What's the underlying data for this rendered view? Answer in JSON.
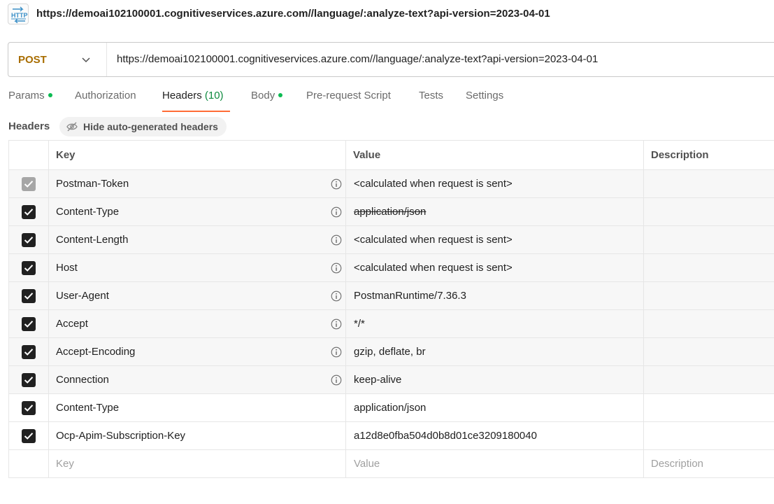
{
  "titlebar": {
    "icon": "http-icon",
    "url": "https://demoai102100001.cognitiveservices.azure.com//language/:analyze-text?api-version=2023-04-01"
  },
  "request": {
    "method": "POST",
    "url": "https://demoai102100001.cognitiveservices.azure.com//language/:analyze-text?api-version=2023-04-01"
  },
  "tabs": [
    {
      "label": "Params",
      "dot": true
    },
    {
      "label": "Authorization",
      "dot": false
    },
    {
      "label": "Headers",
      "count": "(10)",
      "active": true
    },
    {
      "label": "Body",
      "dot": true
    },
    {
      "label": "Pre-request Script",
      "dot": false
    },
    {
      "label": "Tests",
      "dot": false
    },
    {
      "label": "Settings",
      "dot": false
    }
  ],
  "headers_section": {
    "label": "Headers",
    "hide_button": "Hide auto-generated headers"
  },
  "table": {
    "columns": {
      "key": "Key",
      "value": "Value",
      "description": "Description"
    },
    "rows": [
      {
        "key": "Postman-Token",
        "value": "<calculated when request is sent>",
        "checked": true,
        "disabled": true,
        "auto": true,
        "struck": false
      },
      {
        "key": "Content-Type",
        "value": "application/json",
        "checked": true,
        "disabled": false,
        "auto": true,
        "struck": true
      },
      {
        "key": "Content-Length",
        "value": "<calculated when request is sent>",
        "checked": true,
        "disabled": false,
        "auto": true,
        "struck": false
      },
      {
        "key": "Host",
        "value": "<calculated when request is sent>",
        "checked": true,
        "disabled": false,
        "auto": true,
        "struck": false
      },
      {
        "key": "User-Agent",
        "value": "PostmanRuntime/7.36.3",
        "checked": true,
        "disabled": false,
        "auto": true,
        "struck": false
      },
      {
        "key": "Accept",
        "value": "*/*",
        "checked": true,
        "disabled": false,
        "auto": true,
        "struck": false
      },
      {
        "key": "Accept-Encoding",
        "value": "gzip, deflate, br",
        "checked": true,
        "disabled": false,
        "auto": true,
        "struck": false
      },
      {
        "key": "Connection",
        "value": "keep-alive",
        "checked": true,
        "disabled": false,
        "auto": true,
        "struck": false
      },
      {
        "key": "Content-Type",
        "value": "application/json",
        "checked": true,
        "disabled": false,
        "auto": false,
        "struck": false
      },
      {
        "key": "Ocp-Apim-Subscription-Key",
        "value": "a12d8e0fba504d0b8d01ce3209180040",
        "checked": true,
        "disabled": false,
        "auto": false,
        "struck": false
      }
    ],
    "new_row": {
      "key_placeholder": "Key",
      "value_placeholder": "Value",
      "description_placeholder": "Description"
    }
  },
  "colors": {
    "method": "#a86d00",
    "active_tab_underline": "#ff6c37",
    "dot": "#0cbb52",
    "count": "#0d8a3e"
  }
}
